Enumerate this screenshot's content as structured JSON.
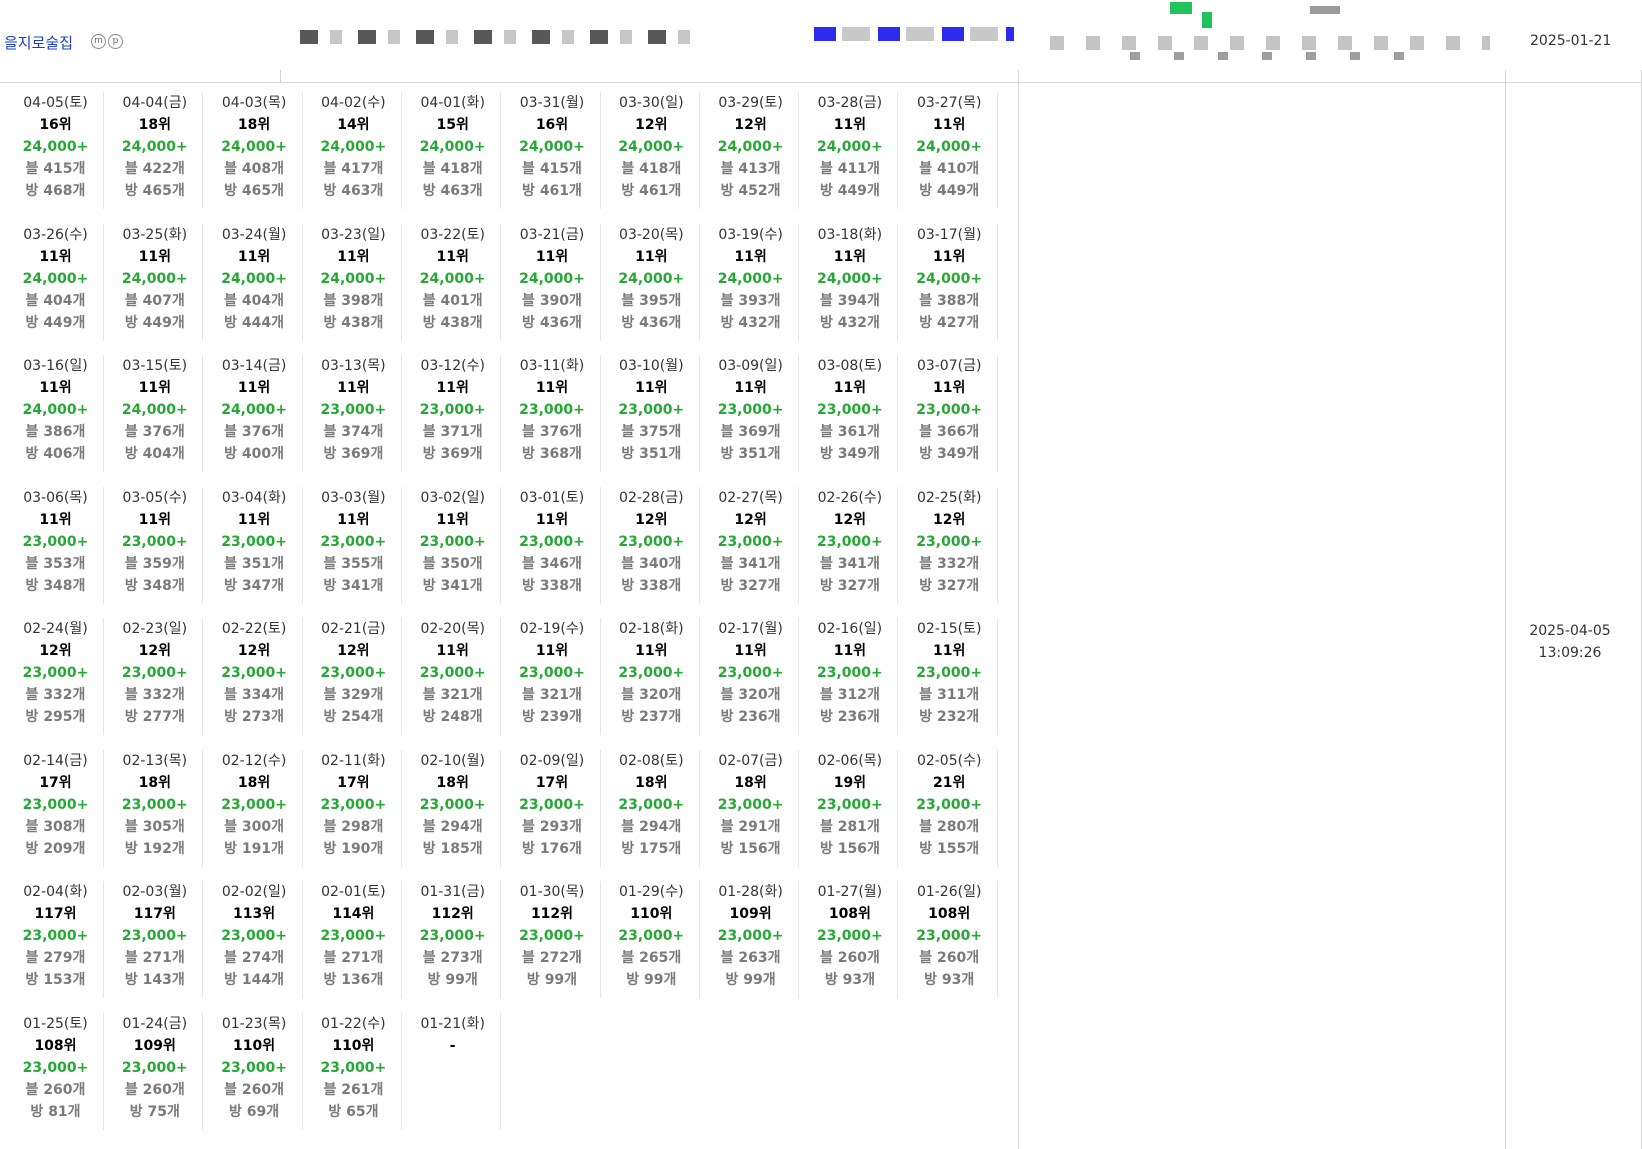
{
  "header": {
    "place_name": "을지로술집",
    "badges": [
      "m",
      "p"
    ],
    "registered_date": "2025-01-21"
  },
  "right_panel": {
    "updated_date": "2025-04-05",
    "updated_time": "13:09:26"
  },
  "colors": {
    "link": "#1a3cc8",
    "score": "#25a834",
    "muted": "#7a7a7a",
    "border": "#d6d6d6"
  },
  "prefix": {
    "blog": "블",
    "visit": "방",
    "unit": "개"
  },
  "history": [
    {
      "date": "04-05(토)",
      "rank": "16위",
      "score": "24,000+",
      "blog": "415",
      "visit": "468"
    },
    {
      "date": "04-04(금)",
      "rank": "18위",
      "score": "24,000+",
      "blog": "422",
      "visit": "465"
    },
    {
      "date": "04-03(목)",
      "rank": "18위",
      "score": "24,000+",
      "blog": "408",
      "visit": "465"
    },
    {
      "date": "04-02(수)",
      "rank": "14위",
      "score": "24,000+",
      "blog": "417",
      "visit": "463"
    },
    {
      "date": "04-01(화)",
      "rank": "15위",
      "score": "24,000+",
      "blog": "418",
      "visit": "463"
    },
    {
      "date": "03-31(월)",
      "rank": "16위",
      "score": "24,000+",
      "blog": "415",
      "visit": "461"
    },
    {
      "date": "03-30(일)",
      "rank": "12위",
      "score": "24,000+",
      "blog": "418",
      "visit": "461"
    },
    {
      "date": "03-29(토)",
      "rank": "12위",
      "score": "24,000+",
      "blog": "413",
      "visit": "452"
    },
    {
      "date": "03-28(금)",
      "rank": "11위",
      "score": "24,000+",
      "blog": "411",
      "visit": "449"
    },
    {
      "date": "03-27(목)",
      "rank": "11위",
      "score": "24,000+",
      "blog": "410",
      "visit": "449"
    },
    {
      "date": "03-26(수)",
      "rank": "11위",
      "score": "24,000+",
      "blog": "404",
      "visit": "449"
    },
    {
      "date": "03-25(화)",
      "rank": "11위",
      "score": "24,000+",
      "blog": "407",
      "visit": "449"
    },
    {
      "date": "03-24(월)",
      "rank": "11위",
      "score": "24,000+",
      "blog": "404",
      "visit": "444"
    },
    {
      "date": "03-23(일)",
      "rank": "11위",
      "score": "24,000+",
      "blog": "398",
      "visit": "438"
    },
    {
      "date": "03-22(토)",
      "rank": "11위",
      "score": "24,000+",
      "blog": "401",
      "visit": "438"
    },
    {
      "date": "03-21(금)",
      "rank": "11위",
      "score": "24,000+",
      "blog": "390",
      "visit": "436"
    },
    {
      "date": "03-20(목)",
      "rank": "11위",
      "score": "24,000+",
      "blog": "395",
      "visit": "436"
    },
    {
      "date": "03-19(수)",
      "rank": "11위",
      "score": "24,000+",
      "blog": "393",
      "visit": "432"
    },
    {
      "date": "03-18(화)",
      "rank": "11위",
      "score": "24,000+",
      "blog": "394",
      "visit": "432"
    },
    {
      "date": "03-17(월)",
      "rank": "11위",
      "score": "24,000+",
      "blog": "388",
      "visit": "427"
    },
    {
      "date": "03-16(일)",
      "rank": "11위",
      "score": "24,000+",
      "blog": "386",
      "visit": "406"
    },
    {
      "date": "03-15(토)",
      "rank": "11위",
      "score": "24,000+",
      "blog": "376",
      "visit": "404"
    },
    {
      "date": "03-14(금)",
      "rank": "11위",
      "score": "24,000+",
      "blog": "376",
      "visit": "400"
    },
    {
      "date": "03-13(목)",
      "rank": "11위",
      "score": "23,000+",
      "blog": "374",
      "visit": "369"
    },
    {
      "date": "03-12(수)",
      "rank": "11위",
      "score": "23,000+",
      "blog": "371",
      "visit": "369"
    },
    {
      "date": "03-11(화)",
      "rank": "11위",
      "score": "23,000+",
      "blog": "376",
      "visit": "368"
    },
    {
      "date": "03-10(월)",
      "rank": "11위",
      "score": "23,000+",
      "blog": "375",
      "visit": "351"
    },
    {
      "date": "03-09(일)",
      "rank": "11위",
      "score": "23,000+",
      "blog": "369",
      "visit": "351"
    },
    {
      "date": "03-08(토)",
      "rank": "11위",
      "score": "23,000+",
      "blog": "361",
      "visit": "349"
    },
    {
      "date": "03-07(금)",
      "rank": "11위",
      "score": "23,000+",
      "blog": "366",
      "visit": "349"
    },
    {
      "date": "03-06(목)",
      "rank": "11위",
      "score": "23,000+",
      "blog": "353",
      "visit": "348"
    },
    {
      "date": "03-05(수)",
      "rank": "11위",
      "score": "23,000+",
      "blog": "359",
      "visit": "348"
    },
    {
      "date": "03-04(화)",
      "rank": "11위",
      "score": "23,000+",
      "blog": "351",
      "visit": "347"
    },
    {
      "date": "03-03(월)",
      "rank": "11위",
      "score": "23,000+",
      "blog": "355",
      "visit": "341"
    },
    {
      "date": "03-02(일)",
      "rank": "11위",
      "score": "23,000+",
      "blog": "350",
      "visit": "341"
    },
    {
      "date": "03-01(토)",
      "rank": "11위",
      "score": "23,000+",
      "blog": "346",
      "visit": "338"
    },
    {
      "date": "02-28(금)",
      "rank": "12위",
      "score": "23,000+",
      "blog": "340",
      "visit": "338"
    },
    {
      "date": "02-27(목)",
      "rank": "12위",
      "score": "23,000+",
      "blog": "341",
      "visit": "327"
    },
    {
      "date": "02-26(수)",
      "rank": "12위",
      "score": "23,000+",
      "blog": "341",
      "visit": "327"
    },
    {
      "date": "02-25(화)",
      "rank": "12위",
      "score": "23,000+",
      "blog": "332",
      "visit": "327"
    },
    {
      "date": "02-24(월)",
      "rank": "12위",
      "score": "23,000+",
      "blog": "332",
      "visit": "295"
    },
    {
      "date": "02-23(일)",
      "rank": "12위",
      "score": "23,000+",
      "blog": "332",
      "visit": "277"
    },
    {
      "date": "02-22(토)",
      "rank": "12위",
      "score": "23,000+",
      "blog": "334",
      "visit": "273"
    },
    {
      "date": "02-21(금)",
      "rank": "12위",
      "score": "23,000+",
      "blog": "329",
      "visit": "254"
    },
    {
      "date": "02-20(목)",
      "rank": "11위",
      "score": "23,000+",
      "blog": "321",
      "visit": "248"
    },
    {
      "date": "02-19(수)",
      "rank": "11위",
      "score": "23,000+",
      "blog": "321",
      "visit": "239"
    },
    {
      "date": "02-18(화)",
      "rank": "11위",
      "score": "23,000+",
      "blog": "320",
      "visit": "237"
    },
    {
      "date": "02-17(월)",
      "rank": "11위",
      "score": "23,000+",
      "blog": "320",
      "visit": "236"
    },
    {
      "date": "02-16(일)",
      "rank": "11위",
      "score": "23,000+",
      "blog": "312",
      "visit": "236"
    },
    {
      "date": "02-15(토)",
      "rank": "11위",
      "score": "23,000+",
      "blog": "311",
      "visit": "232"
    },
    {
      "date": "02-14(금)",
      "rank": "17위",
      "score": "23,000+",
      "blog": "308",
      "visit": "209"
    },
    {
      "date": "02-13(목)",
      "rank": "18위",
      "score": "23,000+",
      "blog": "305",
      "visit": "192"
    },
    {
      "date": "02-12(수)",
      "rank": "18위",
      "score": "23,000+",
      "blog": "300",
      "visit": "191"
    },
    {
      "date": "02-11(화)",
      "rank": "17위",
      "score": "23,000+",
      "blog": "298",
      "visit": "190"
    },
    {
      "date": "02-10(월)",
      "rank": "18위",
      "score": "23,000+",
      "blog": "294",
      "visit": "185"
    },
    {
      "date": "02-09(일)",
      "rank": "17위",
      "score": "23,000+",
      "blog": "293",
      "visit": "176"
    },
    {
      "date": "02-08(토)",
      "rank": "18위",
      "score": "23,000+",
      "blog": "294",
      "visit": "175"
    },
    {
      "date": "02-07(금)",
      "rank": "18위",
      "score": "23,000+",
      "blog": "291",
      "visit": "156"
    },
    {
      "date": "02-06(목)",
      "rank": "19위",
      "score": "23,000+",
      "blog": "281",
      "visit": "156"
    },
    {
      "date": "02-05(수)",
      "rank": "21위",
      "score": "23,000+",
      "blog": "280",
      "visit": "155"
    },
    {
      "date": "02-04(화)",
      "rank": "117위",
      "score": "23,000+",
      "blog": "279",
      "visit": "153"
    },
    {
      "date": "02-03(월)",
      "rank": "117위",
      "score": "23,000+",
      "blog": "271",
      "visit": "143"
    },
    {
      "date": "02-02(일)",
      "rank": "113위",
      "score": "23,000+",
      "blog": "274",
      "visit": "144"
    },
    {
      "date": "02-01(토)",
      "rank": "114위",
      "score": "23,000+",
      "blog": "271",
      "visit": "136"
    },
    {
      "date": "01-31(금)",
      "rank": "112위",
      "score": "23,000+",
      "blog": "273",
      "visit": "99"
    },
    {
      "date": "01-30(목)",
      "rank": "112위",
      "score": "23,000+",
      "blog": "272",
      "visit": "99"
    },
    {
      "date": "01-29(수)",
      "rank": "110위",
      "score": "23,000+",
      "blog": "265",
      "visit": "99"
    },
    {
      "date": "01-28(화)",
      "rank": "109위",
      "score": "23,000+",
      "blog": "263",
      "visit": "99"
    },
    {
      "date": "01-27(월)",
      "rank": "108위",
      "score": "23,000+",
      "blog": "260",
      "visit": "93"
    },
    {
      "date": "01-26(일)",
      "rank": "108위",
      "score": "23,000+",
      "blog": "260",
      "visit": "93"
    },
    {
      "date": "01-25(토)",
      "rank": "108위",
      "score": "23,000+",
      "blog": "260",
      "visit": "81"
    },
    {
      "date": "01-24(금)",
      "rank": "109위",
      "score": "23,000+",
      "blog": "260",
      "visit": "75"
    },
    {
      "date": "01-23(목)",
      "rank": "110위",
      "score": "23,000+",
      "blog": "260",
      "visit": "69"
    },
    {
      "date": "01-22(수)",
      "rank": "110위",
      "score": "23,000+",
      "blog": "261",
      "visit": "65"
    },
    {
      "date": "01-21(화)",
      "rank": "-"
    }
  ]
}
